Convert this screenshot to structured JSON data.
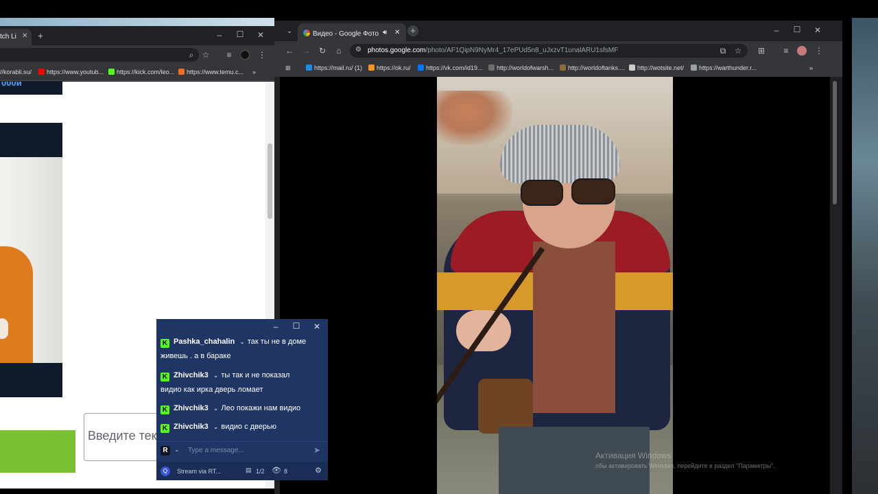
{
  "left_browser": {
    "tab_title": "tch Li",
    "bookmarks": [
      "//korabli.su/",
      "https://www.youtub...",
      "https://kick.com/leo...",
      "https://www.temu.c..."
    ],
    "partial_heading": "000и",
    "input_placeholder": "Введите тек"
  },
  "right_browser": {
    "tab_title": "Видео - Google Фото",
    "url_domain": "photos.google.com",
    "url_path": "/photo/AF1QipN9NyMr4_17ePUd5n8_uJxzvT1unalARU1sfsMF",
    "bookmarks": [
      {
        "label": "https://mail.ru/ (1)",
        "color": "#168de2"
      },
      {
        "label": "https://ok.ru/",
        "color": "#f7931e"
      },
      {
        "label": "https://vk.com/id19...",
        "color": "#0077ff"
      },
      {
        "label": "http://worldofwarsh...",
        "color": "#6d6d6d"
      },
      {
        "label": "http://worldoftanks....",
        "color": "#8a6d3b"
      },
      {
        "label": "http://wotsite.net/",
        "color": "#cccccc"
      },
      {
        "label": "https://warthunder.r...",
        "color": "#9aa0a6"
      }
    ]
  },
  "chat": {
    "messages": [
      {
        "user": "Pashka_chahalin",
        "text_inline": "так ты не в доме",
        "text_wrap": "живешь . а в бараке"
      },
      {
        "user": "Zhivchik3",
        "text_inline": "ты так и не показал",
        "text_wrap": "видио как ирка дверь ломает"
      },
      {
        "user": "Zhivchik3",
        "text_inline": "Лео покажи нам видио",
        "text_wrap": ""
      },
      {
        "user": "Zhivchik3",
        "text_inline": "видио с дверью",
        "text_wrap": ""
      }
    ],
    "input_placeholder": "Type a message...",
    "avatar_letter": "R",
    "footer_label": "Stream via RT...",
    "page_indicator": "1/2",
    "viewer_count": "8"
  },
  "watermark": {
    "title": "Активация Windows",
    "subtitle": "обы активировать Windows, перейдите в раздел \"Параметры\"."
  },
  "colors": {
    "kick_green": "#53fc18",
    "chat_bg": "#1f3564",
    "chrome_dark": "#202124",
    "chrome_toolbar": "#35363a"
  }
}
